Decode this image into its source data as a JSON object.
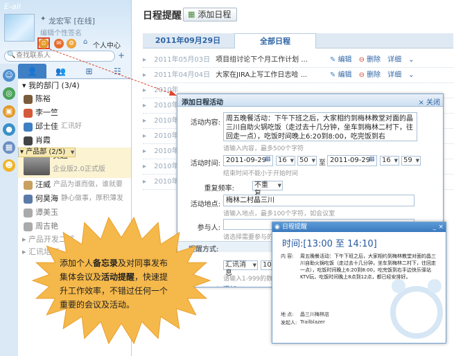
{
  "im": {
    "logo": "E-all",
    "nickname": "龙宏军 [在线]",
    "signature": "编辑个性签名",
    "personal_center": "个人中心",
    "search_placeholder": "查找联系人",
    "groups": [
      {
        "label": "我的部门 (3/4)",
        "contacts": [
          {
            "name": "陈裕",
            "signature": ""
          },
          {
            "name": "李一竺",
            "signature": ""
          },
          {
            "name": "邱士佳",
            "signature": "汇讯好"
          },
          {
            "name": "肖霞",
            "signature": ""
          }
        ]
      },
      {
        "label": "产品部 (2/5)",
        "contacts": [
          {
            "name": "黄超",
            "signature": "企业版2.0正式版"
          },
          {
            "name": "汪威",
            "signature": "产品为谁而做，谁就要"
          },
          {
            "name": "何昊海",
            "signature": "静心做事，厚积薄发"
          },
          {
            "name": "谭美玉",
            "signature": ""
          },
          {
            "name": "周吉艳",
            "signature": ""
          }
        ]
      },
      {
        "label": "产品开发二部",
        "contacts": []
      },
      {
        "label": "汇讯培训",
        "contacts": []
      }
    ]
  },
  "calendar": {
    "title": "日程提醒",
    "add_button": "添加日程",
    "tab_date": "2011年09月29日",
    "tab_all": "全部日程",
    "rows": [
      {
        "date": "2011年05月03日",
        "text": "项目组讨论下个月工作计划 ...",
        "edit": "编辑",
        "delete": "删除",
        "detail": "详细"
      },
      {
        "date": "2011年04月04日",
        "text": "大家在JIRA上写工作日志哈 ...",
        "edit": "编辑",
        "delete": "删除",
        "detail": "详细"
      },
      {
        "date": "2010年",
        "text": "",
        "edit": "",
        "delete": "",
        "detail": ""
      },
      {
        "date": "2010年",
        "text": "",
        "edit": "",
        "delete": "",
        "detail": ""
      },
      {
        "date": "2010年",
        "text": "",
        "edit": "",
        "delete": "",
        "detail": ""
      },
      {
        "date": "2010年",
        "text": "",
        "edit": "",
        "delete": "",
        "detail": ""
      },
      {
        "date": "2010年",
        "text": "",
        "edit": "",
        "delete": "",
        "detail": ""
      },
      {
        "date": "2010年",
        "text": "",
        "edit": "",
        "delete": "",
        "detail": ""
      },
      {
        "date": "2010年",
        "text": "",
        "edit": "",
        "delete": "",
        "detail": ""
      }
    ]
  },
  "dialog": {
    "title": "添加日程活动",
    "close": "关闭",
    "content_label": "活动内容:",
    "content_value": "周五晚餐活动：下午下班之后，大家相约到梅林教堂对面的晶三川自助火锅吃饭（走过去十几分钟，坐车到梅林二村下，往回走一点），吃饭时间晚上6:20到8:00，吃完饭到右",
    "content_hint": "请输入内容，最多500个字符",
    "time_label": "活动时间:",
    "start_date": "2011-09-29",
    "start_hour": "16",
    "start_min": "50",
    "to": "至",
    "end_date": "2011-09-29",
    "end_hour": "16",
    "end_min": "59",
    "time_hint": "结束时间不能小于开始时间",
    "repeat_label": "重复频率:",
    "repeat_value": "不重复",
    "place_label": "活动地点:",
    "place_value": "梅林二村晶三川",
    "place_hint": "请输入地点，最多100个字符，如会议室",
    "people_label": "参与人:",
    "people_hint": "请选择需要参与的",
    "remind_label": "提醒方式:",
    "remind_value": "汇讯消息",
    "remind_num": "10",
    "remind_hint": "请输入1-999的数字",
    "add_link": "添加"
  },
  "popup": {
    "title": "日程提醒",
    "time": "时间:[13:00 至 14:10]",
    "content_label": "内 容:",
    "content": "周五晚餐活动：下午下班之后，大家相约到梅林教堂对面的晶三川自助火锅吃饭（走过去十几分钟，坐车到梅林二村下，往回走一点），吃饭时间晚上6:20到8:00，吃完饭到右手边快乐驿站KTV玩，吃饭时间晚上8点到12点，都已经安排好。",
    "place_label": "地 点:",
    "place": "晶三川梅林店",
    "sender_label": "发起人:",
    "sender": "Trailblazer"
  },
  "callout": {
    "line1_a": "添加个人",
    "line1_b": "备忘录",
    "line1_c": "及对同事发布",
    "line2_a": "集体会议及",
    "line2_b": "活动提醒",
    "line2_c": "，快速提",
    "line3": "升工作效率，不错过任何一个",
    "line4": "重要的会议及活动。"
  },
  "colors": {
    "accent": "#3f7fc4",
    "burst": "#f5b84a",
    "highlight": "#f6e9b3",
    "pointer": "#e0452e"
  }
}
